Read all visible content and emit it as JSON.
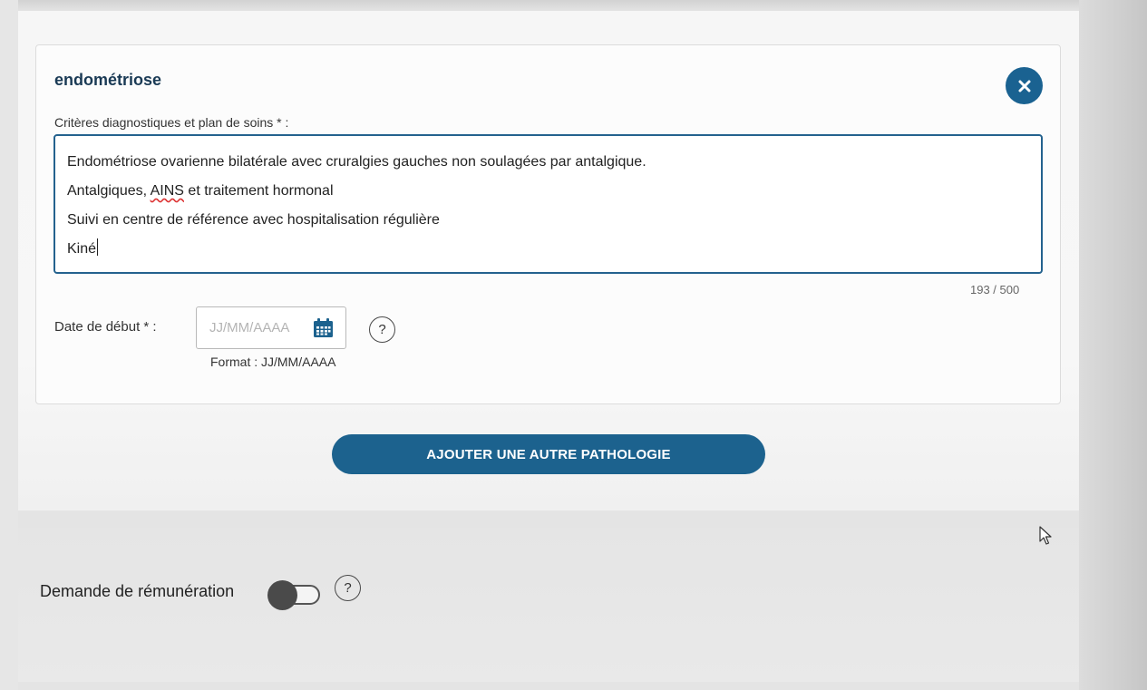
{
  "pathology": {
    "title": "endométriose",
    "criteria_label": "Critères diagnostiques et plan de soins * :",
    "criteria_lines": [
      "Endométriose ovarienne bilatérale avec cruralgies gauches non soulagées par antalgique.",
      "Antalgiques, ",
      "Suivi en centre de référence avec hospitalisation régulière",
      "Kiné"
    ],
    "criteria_spellcheck_word": "AINS",
    "criteria_line2_rest": " et traitement hormonal",
    "char_counter": "193 / 500",
    "start_date_label": "Date de début * :",
    "start_date_placeholder": "JJ/MM/AAAA",
    "start_date_help": "?",
    "start_date_format": "Format : JJ/MM/AAAA"
  },
  "actions": {
    "add_pathology_label": "AJOUTER UNE AUTRE PATHOLOGIE"
  },
  "remuneration": {
    "label": "Demande de rémunération",
    "enabled": false,
    "help": "?"
  },
  "icons": {
    "close": "close-icon",
    "calendar": "calendar-icon",
    "help": "help-icon",
    "pointer": "mouse-pointer-icon"
  },
  "colors": {
    "primary": "#1c628e",
    "title": "#1a3a55",
    "spellcheck": "#dd3333"
  }
}
